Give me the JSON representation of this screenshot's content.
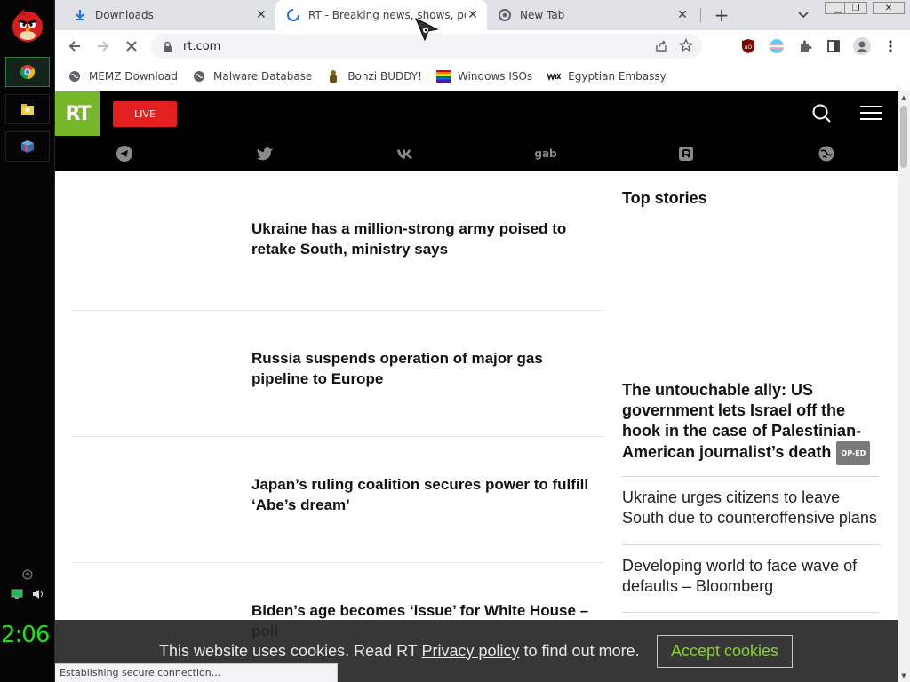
{
  "taskbar": {
    "clock": "2:06"
  },
  "browser": {
    "tabs": [
      {
        "title": "Downloads",
        "icon": "download-icon"
      },
      {
        "title": "RT - Breaking news, shows, podcasts",
        "icon": "loading-spinner-icon"
      },
      {
        "title": "New Tab",
        "icon": "chrome-icon"
      }
    ],
    "url": "rt.com",
    "bookmarks": [
      {
        "label": "MEMZ Download",
        "icon": "globe-icon"
      },
      {
        "label": "Malware Database",
        "icon": "globe-icon"
      },
      {
        "label": "Bonzi BUDDY!",
        "icon": "bonzi-icon"
      },
      {
        "label": "Windows ISOs",
        "icon": "rainbow-flag-icon"
      },
      {
        "label": "Egyptian Embassy",
        "icon": "wix-icon"
      }
    ],
    "status": "Establishing secure connection..."
  },
  "site": {
    "logo": "RT",
    "live_label": "LIVE",
    "social": [
      "telegram",
      "twitter",
      "vk",
      "gab",
      "rumble",
      "odysee"
    ],
    "gab_label": "gab",
    "news": [
      "Ukraine has a million-strong army poised to retake South, ministry says",
      "Russia suspends operation of major gas pipeline to Europe",
      "Japan’s ruling coalition secures power to fulfill ‘Abe’s dream’",
      "Biden’s age becomes ‘issue’ for White House – poll"
    ],
    "sidebar": {
      "title": "Top stories",
      "feature": "The untouchable ally: US government lets Israel off the hook in the case of Palestinian-American journalist’s death",
      "feature_badge": "OP-ED",
      "items": [
        "Ukraine urges citizens to leave South due to counteroffensive plans",
        "Developing world to face wave of defaults – Bloomberg"
      ]
    },
    "cookie": {
      "text_before": "This website uses cookies. Read RT ",
      "link": "Privacy policy",
      "text_after": " to find out more.",
      "accept": "Accept cookies"
    }
  },
  "colors": {
    "rt_green": "#77b82a",
    "live_red": "#e41f1f",
    "accept_green": "#8bd12d",
    "clock_green": "#1de01d"
  }
}
